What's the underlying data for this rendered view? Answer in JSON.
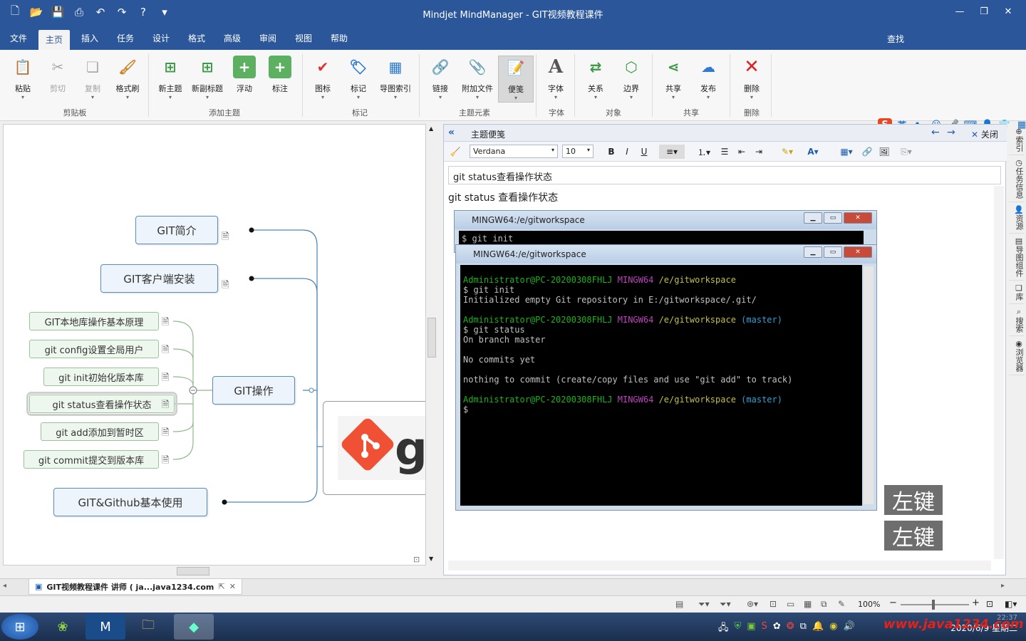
{
  "app": {
    "title": "Mindjet MindManager - GIT视频教程课件"
  },
  "menu": {
    "items": [
      "文件",
      "主页",
      "插入",
      "任务",
      "设计",
      "格式",
      "高级",
      "审阅",
      "视图",
      "帮助"
    ],
    "active": "主页",
    "find_label": "查找"
  },
  "ribbon": {
    "buttons": {
      "paste": "粘贴",
      "cut": "剪切",
      "copy": "复制",
      "format_painter": "格式刷",
      "new_topic": "新主题",
      "new_subtopic": "新副标题",
      "float": "浮动",
      "callout": "标注",
      "icon": "图标",
      "tag": "标记",
      "map_index": "导图索引",
      "link": "链接",
      "attach": "附加文件",
      "notes": "便笺",
      "font": "字体",
      "relation": "关系",
      "boundary": "边界",
      "share": "共享",
      "publish": "发布",
      "delete": "删除"
    },
    "groups": {
      "clipboard": "剪贴板",
      "add_topic": "添加主题",
      "markers": "标记",
      "topic_elements": "主题元素",
      "font": "字体",
      "objects": "对象",
      "share": "共享",
      "delete": "删除"
    }
  },
  "ime": {
    "logo": "S",
    "lang": "英"
  },
  "mindmap": {
    "topics": {
      "intro": "GIT简介",
      "client": "GIT客户端安装",
      "ops": "GIT操作",
      "github": "GIT&Github基本使用"
    },
    "subtopics": {
      "s1": "GIT本地库操作基本原理",
      "s2": "git config设置全局用户",
      "s3": "git init初始化版本库",
      "s4": "git status查看操作状态",
      "s5": "git add添加到暂时区",
      "s6": "git commit提交到版本库"
    }
  },
  "notes_panel": {
    "title": "主题便笺",
    "close": "关闭",
    "font": "Verdana",
    "size": "10",
    "note_title": "git status查看操作状态",
    "body_heading": "git status 查看操作状态"
  },
  "terminal_back": {
    "title": "MINGW64:/e/gitworkspace",
    "line1": "$ git init"
  },
  "terminal_front": {
    "title": "MINGW64:/e/gitworkspace",
    "lines": {
      "p1_user": "Administrator@PC-20200308FHLJ",
      "p1_env": "MINGW64",
      "p1_path": "/e/gitworkspace",
      "c1": "$ git init",
      "o1": "Initialized empty Git repository in E:/gitworkspace/.git/",
      "p2_user": "Administrator@PC-20200308FHLJ",
      "p2_env": "MINGW64",
      "p2_path": "/e/gitworkspace",
      "p2_branch": "(master)",
      "c2": "$ git status",
      "o2": "On branch master",
      "o3": "No commits yet",
      "o4": "nothing to commit (create/copy files and use \"git add\" to track)",
      "p3_user": "Administrator@PC-20200308FHLJ",
      "p3_env": "MINGW64",
      "p3_path": "/e/gitworkspace",
      "p3_branch": "(master)",
      "c3": "$"
    }
  },
  "key_badges": [
    "左键",
    "左键"
  ],
  "side_tabs": [
    "索引",
    "任务信息",
    "资源",
    "导图组件",
    "库",
    "搜索",
    "浏览器"
  ],
  "doc_tab": {
    "label": "GIT视频教程课件 讲师 ( ja...java1234.com"
  },
  "status": {
    "zoom": "100%"
  },
  "taskbar": {
    "clock_time": "22:37",
    "clock_date": "2020/6/9 星期二",
    "watermark": "www.java1234.com"
  }
}
